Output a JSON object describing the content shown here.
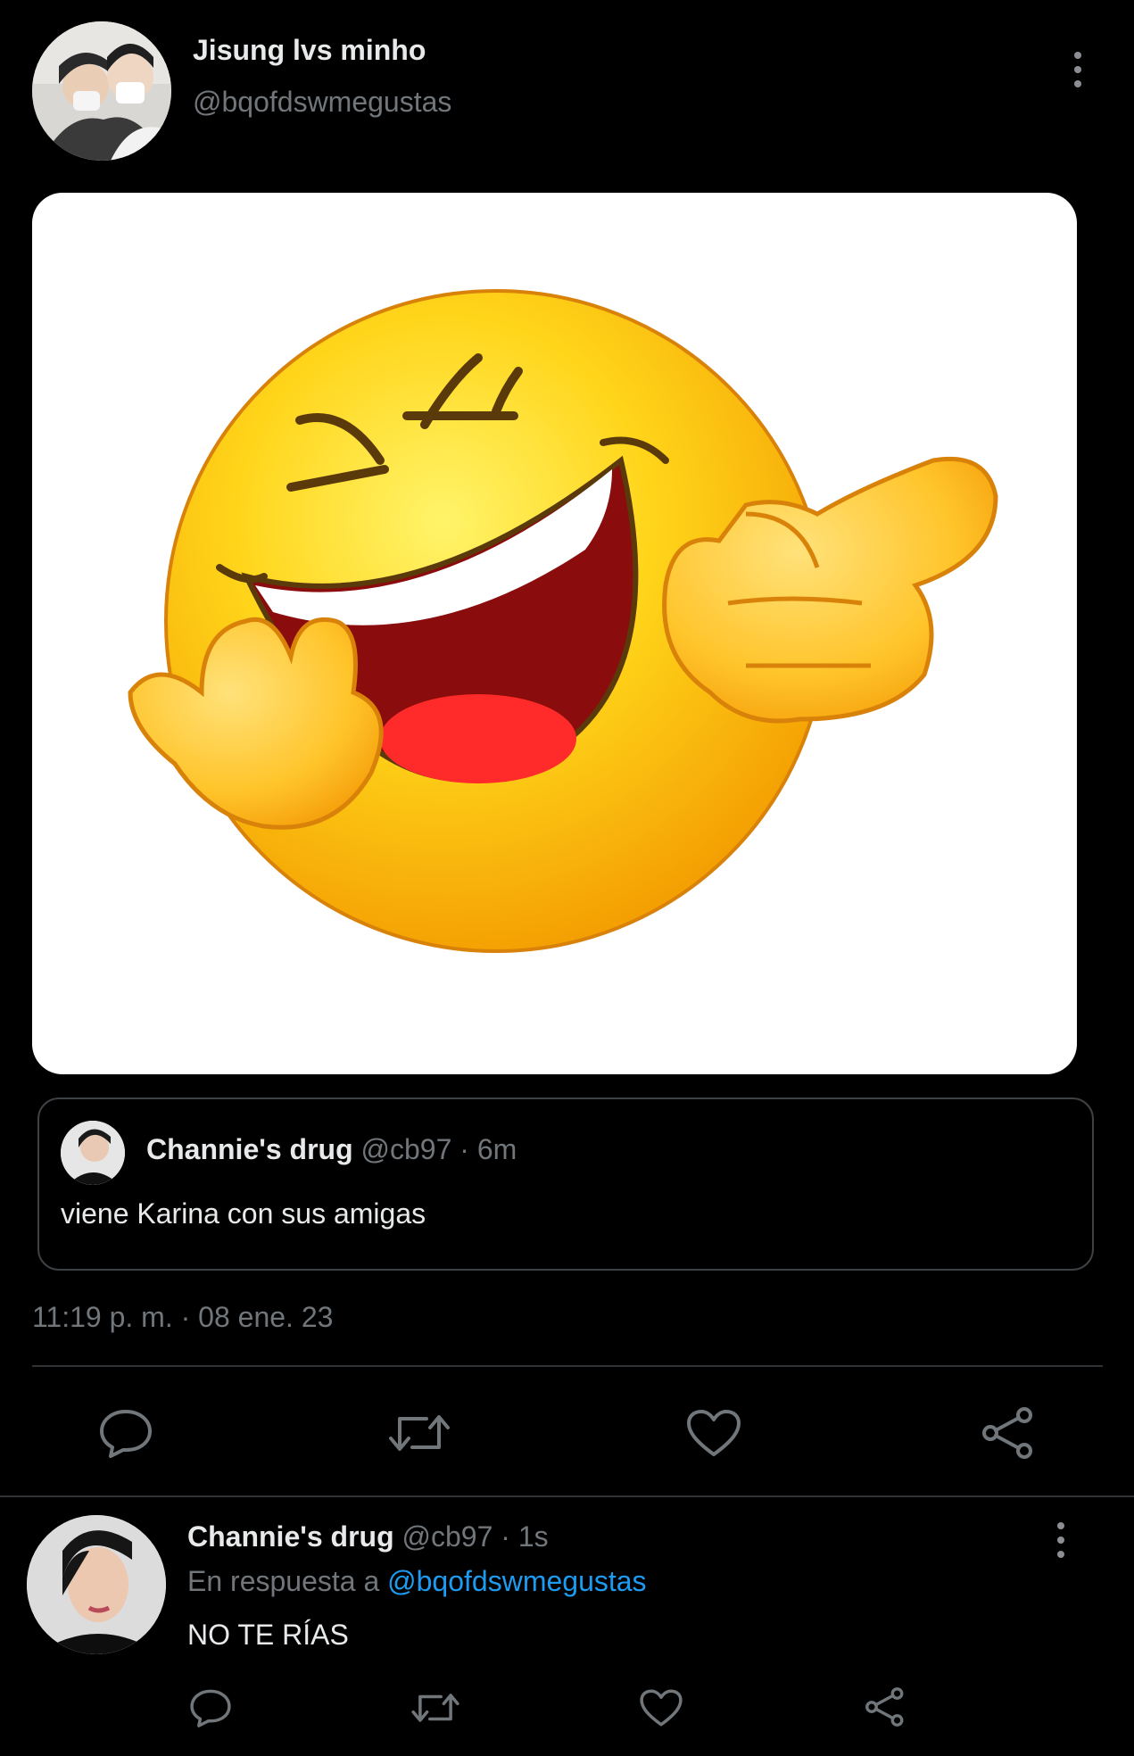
{
  "tweet": {
    "author_name": "Jisung lvs minho",
    "author_handle": "@bqofdswmegustas",
    "timestamp": "11:19 p. m. · 08 ene. 23",
    "media_icon": "laughing-pointing-emoji",
    "quoted": {
      "author_name": "Channie's drug",
      "author_handle": "@cb97",
      "age": "· 6m",
      "text": "viene Karina con sus amigas"
    },
    "actions": [
      "reply-icon",
      "retweet-icon",
      "like-icon",
      "share-icon"
    ]
  },
  "reply": {
    "author_name": "Channie's drug",
    "author_handle": "@cb97",
    "age": "· 1s",
    "reply_prefix": "En respuesta a",
    "reply_to": "@bqofdswmegustas",
    "text": "NO TE RÍAS",
    "actions": [
      "reply-icon",
      "retweet-icon",
      "like-icon",
      "share-icon"
    ]
  },
  "colors": {
    "background": "#000000",
    "text": "#e7e9ea",
    "muted": "#71767b",
    "link": "#1d9bf0",
    "border": "#2f3336"
  }
}
